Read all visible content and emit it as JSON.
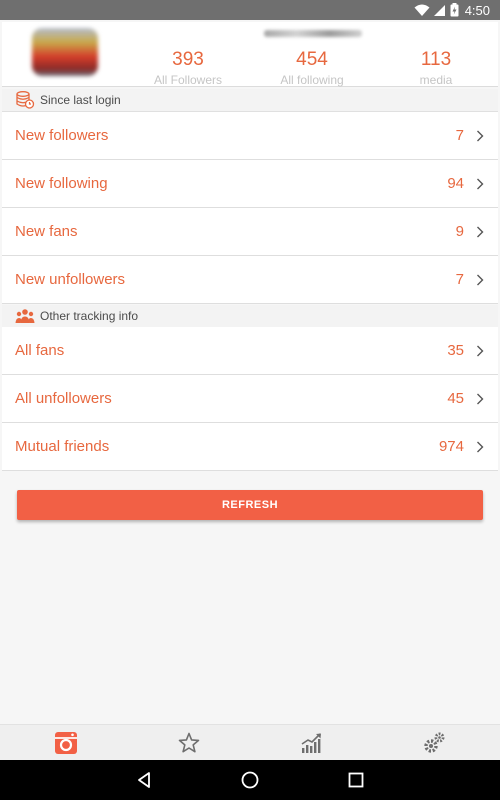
{
  "status_bar": {
    "time": "4:50"
  },
  "profile": {
    "stats": [
      {
        "value": "393",
        "label": "All Followers"
      },
      {
        "value": "454",
        "label": "All following"
      },
      {
        "value": "113",
        "label": "media"
      }
    ]
  },
  "sections": [
    {
      "title": "Since last login",
      "icon": "database-clock-icon",
      "rows": [
        {
          "label": "New followers",
          "count": "7"
        },
        {
          "label": "New following",
          "count": "94"
        },
        {
          "label": "New fans",
          "count": "9"
        },
        {
          "label": "New unfollowers",
          "count": "7"
        }
      ]
    },
    {
      "title": "Other tracking info",
      "icon": "people-icon",
      "rows": [
        {
          "label": "All fans",
          "count": "35"
        },
        {
          "label": "All unfollowers",
          "count": "45"
        },
        {
          "label": "Mutual friends",
          "count": "974"
        }
      ]
    }
  ],
  "refresh_label": "REFRESH",
  "bottom_nav": [
    "camera-icon",
    "star-icon",
    "chart-icon",
    "gears-icon"
  ],
  "colors": {
    "accent": "#e7683f",
    "button": "#f26045",
    "muted": "#c5c5c5"
  }
}
